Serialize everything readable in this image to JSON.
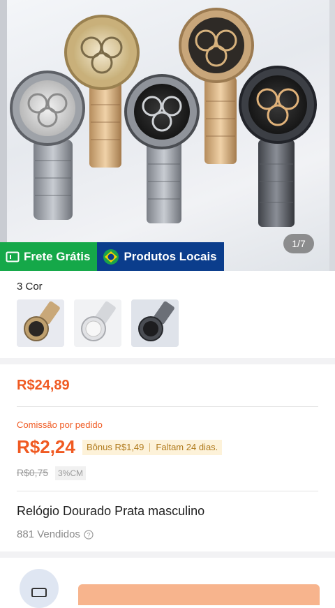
{
  "hero": {
    "image_counter": "1/7",
    "badges": {
      "free_shipping": "Frete Grátis",
      "local_products": "Produtos Locais"
    }
  },
  "colors": {
    "label": "3 Cor",
    "options": [
      "gold-watch-thumb",
      "silver-watch-thumb",
      "black-watch-thumb"
    ]
  },
  "pricing": {
    "price": "R$24,89",
    "commission_label": "Comissão por pedido",
    "commission_value": "R$2,24",
    "bonus_text": "Bônus R$1,49",
    "remaining_text": "Faltam 24 dias.",
    "old_commission": "R$0,75",
    "cm_rate": "3%CM"
  },
  "product": {
    "title": "Relógio Dourado Prata masculino",
    "sold": "881 Vendidos"
  },
  "theme": {
    "accent": "#f05a22",
    "green_badge": "#15a849",
    "blue_badge": "#0b3d8c",
    "cta": "#f7b48d"
  }
}
